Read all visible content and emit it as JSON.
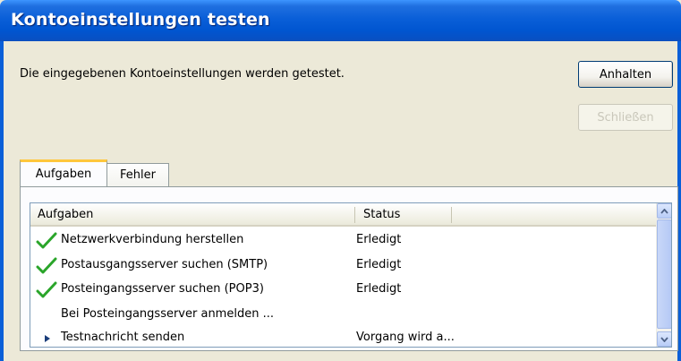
{
  "window": {
    "title": "Kontoeinstellungen testen"
  },
  "description": "Die eingegebenen Kontoeinstellungen werden getestet.",
  "buttons": {
    "stop": "Anhalten",
    "close": "Schließen"
  },
  "tabs": [
    {
      "label": "Aufgaben",
      "active": true
    },
    {
      "label": "Fehler",
      "active": false
    }
  ],
  "list": {
    "columns": [
      "Aufgaben",
      "Status"
    ],
    "rows": [
      {
        "icon": "checkmark-icon",
        "task": "Netzwerkverbindung herstellen",
        "status": "Erledigt"
      },
      {
        "icon": "checkmark-icon",
        "task": "Postausgangsserver suchen (SMTP)",
        "status": "Erledigt"
      },
      {
        "icon": "checkmark-icon",
        "task": "Posteingangsserver suchen (POP3)",
        "status": "Erledigt"
      },
      {
        "icon": "",
        "task": "Bei Posteingangsserver anmelden ...",
        "status": ""
      },
      {
        "icon": "arrow-right-icon",
        "task": "Testnachricht senden",
        "status": "Vorgang wird a..."
      }
    ]
  },
  "colors": {
    "titlebar": "#0055d0",
    "check_green": "#2aa52a",
    "active_tab_accent": "#ffc73c"
  }
}
